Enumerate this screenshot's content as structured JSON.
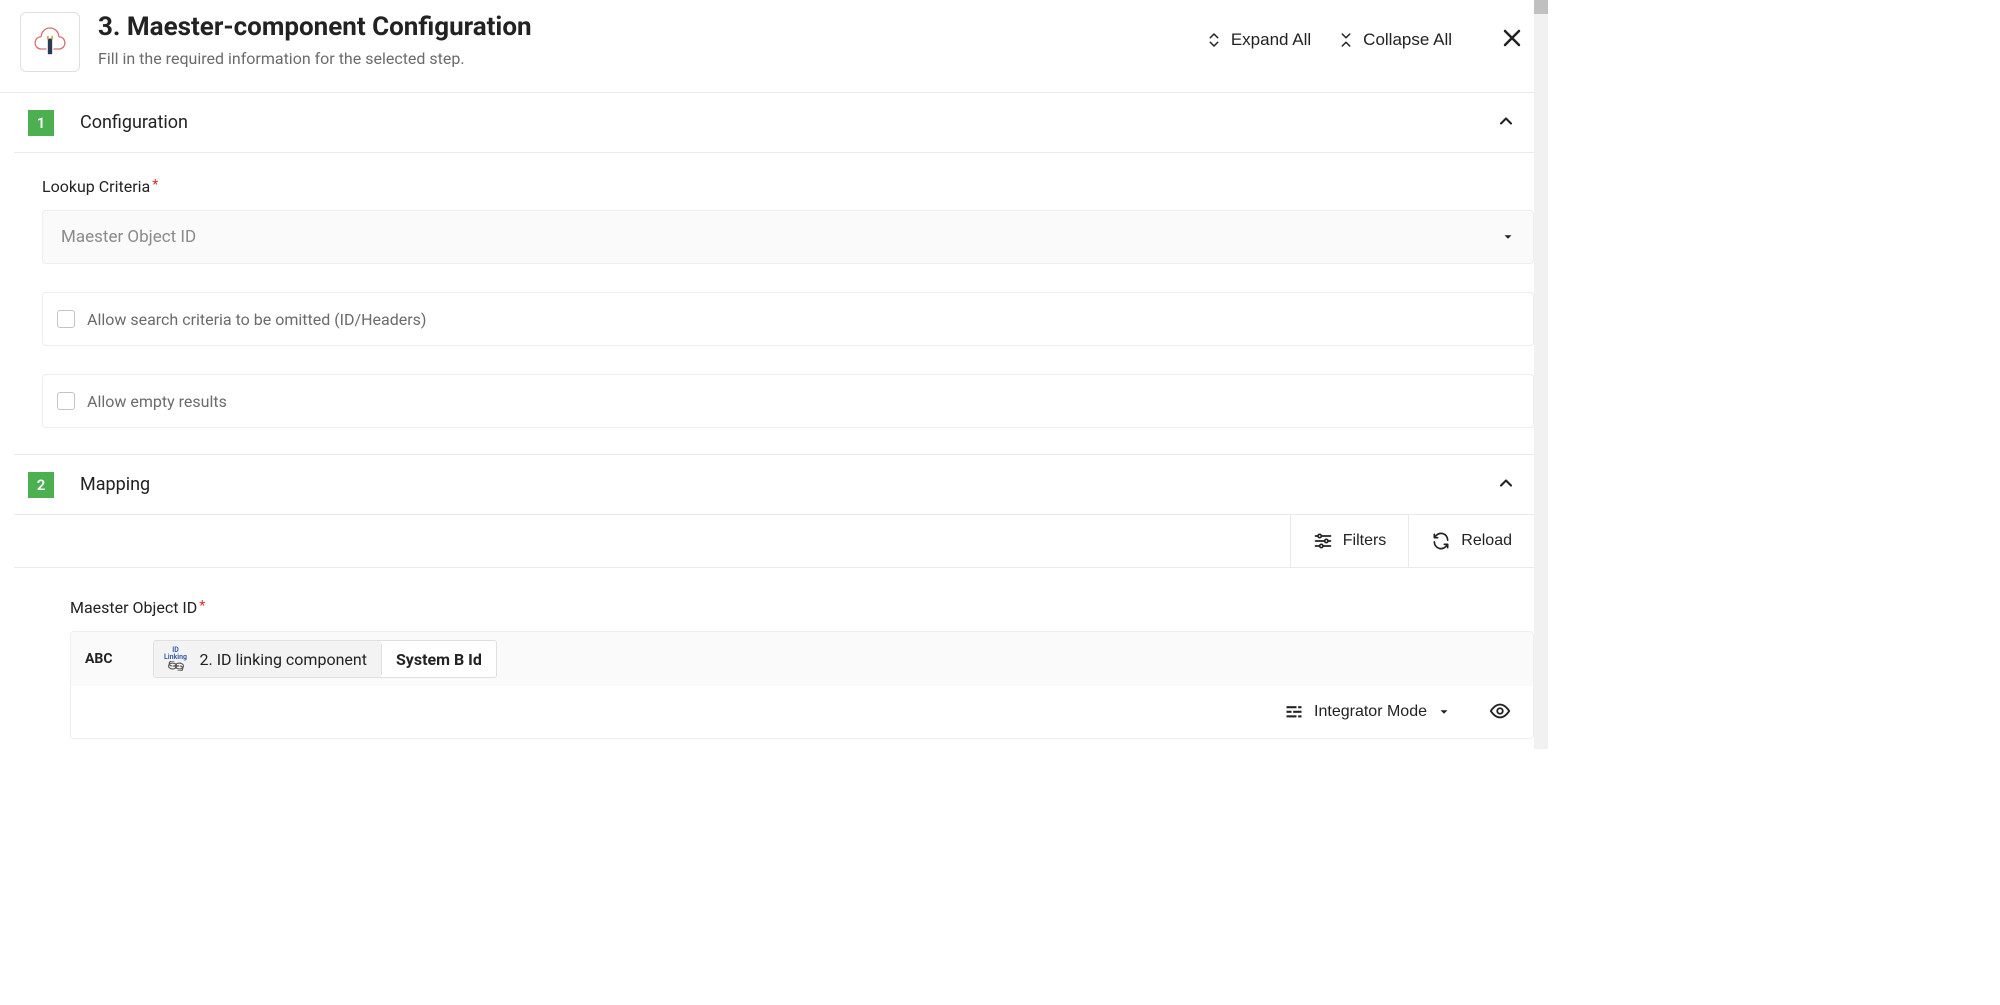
{
  "header": {
    "title": "3. Maester-component Configuration",
    "subtitle": "Fill in the required information for the selected step.",
    "expand_all": "Expand All",
    "collapse_all": "Collapse All"
  },
  "sections": {
    "configuration": {
      "number": "1",
      "title": "Configuration",
      "lookup_criteria_label": "Lookup Criteria",
      "lookup_criteria_value": "Maester Object ID",
      "checkbox1": "Allow search criteria to be omitted (ID/Headers)",
      "checkbox2": "Allow empty results"
    },
    "mapping": {
      "number": "2",
      "title": "Mapping",
      "filters": "Filters",
      "reload": "Reload",
      "field_label": "Maester Object ID",
      "abc": "ABC",
      "chip_icon_top": "ID",
      "chip_icon_bottom": "Linking",
      "chip_left": "2. ID linking component",
      "chip_right": "System B Id",
      "mode": "Integrator Mode"
    }
  }
}
